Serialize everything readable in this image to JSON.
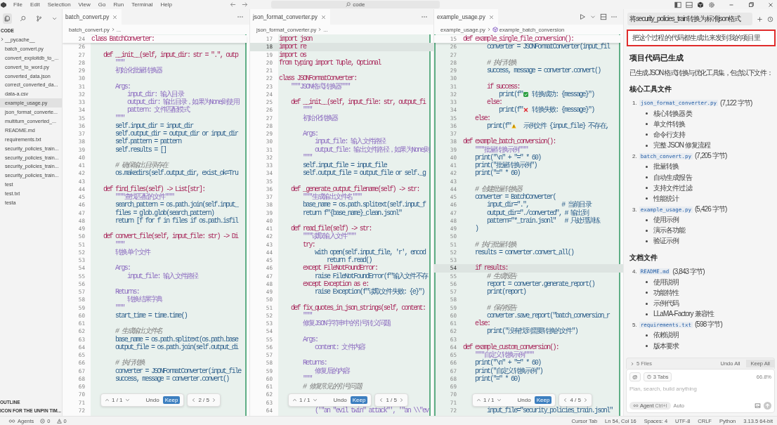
{
  "menu": [
    "File",
    "Edit",
    "Selection",
    "View",
    "Go",
    "Run",
    "Terminal",
    "Help"
  ],
  "search": {
    "value": "code"
  },
  "sidebar": {
    "title": "CODE",
    "files": [
      {
        "name": "__pycache__",
        "kind": "folder",
        "selected": false
      },
      {
        "name": "batch_convert.py",
        "kind": "file",
        "selected": false
      },
      {
        "name": "convert_exploitdb_to_...",
        "kind": "file",
        "selected": false
      },
      {
        "name": "convert_to_word.py",
        "kind": "file",
        "selected": false
      },
      {
        "name": "converted_data.json",
        "kind": "file",
        "selected": false
      },
      {
        "name": "correct_converted_da...",
        "kind": "file",
        "selected": false
      },
      {
        "name": "data-a.csv",
        "kind": "file",
        "selected": false
      },
      {
        "name": "example_usage.py",
        "kind": "file",
        "selected": true
      },
      {
        "name": "json_format_converte...",
        "kind": "file",
        "selected": false
      },
      {
        "name": "multiturn_converted_...",
        "kind": "file",
        "selected": false
      },
      {
        "name": "README.md",
        "kind": "file",
        "selected": false
      },
      {
        "name": "requirements.txt",
        "kind": "file",
        "selected": false
      },
      {
        "name": "security_policies_train...",
        "kind": "file",
        "selected": false
      },
      {
        "name": "security_policies_train...",
        "kind": "file",
        "selected": false
      },
      {
        "name": "security_policies_train...",
        "kind": "file",
        "selected": false
      },
      {
        "name": "security_policies_train...",
        "kind": "file",
        "selected": false
      },
      {
        "name": "test",
        "kind": "file",
        "selected": false
      },
      {
        "name": "test.txt",
        "kind": "file",
        "selected": false
      },
      {
        "name": "testa",
        "kind": "file",
        "selected": false
      }
    ],
    "sections": [
      "OUTLINE",
      "ICON FOR THE UNPIN TIM..."
    ]
  },
  "panes": [
    {
      "tab": "batch_convert.py",
      "breadcrumb": "batch_convert.py",
      "crumb_more": "...",
      "run_controls": false,
      "sticky": {
        "n": "24",
        "text": "class BatchConverter:",
        "kind": "kw"
      },
      "review": {
        "hunk": "1 / 1",
        "undo": "Undo",
        "keep": "Keep",
        "file_counter": "2 / 5"
      },
      "lines": [
        {
          "n": "26",
          "kind": "blank",
          "current": false
        },
        {
          "n": "27",
          "text": "    def __init__(self, input_dir: str = \".\", outp",
          "kind": "kw",
          "current": false
        },
        {
          "n": "28",
          "text": "        \"\"\"",
          "kind": "doc",
          "current": false
        },
        {
          "n": "29",
          "text": "        初始化批量转换器",
          "kind": "doc",
          "current": false
        },
        {
          "n": "30",
          "kind": "blank",
          "current": false
        },
        {
          "n": "31",
          "text": "        Args:",
          "kind": "doc",
          "current": false
        },
        {
          "n": "32",
          "text": "            input_dir: 输入目录",
          "kind": "doc",
          "current": false
        },
        {
          "n": "33",
          "text": "            output_dir: 输出目录，如果为None则使用",
          "kind": "doc",
          "current": false
        },
        {
          "n": "34",
          "text": "            pattern: 文件匹配模式",
          "kind": "doc",
          "current": false
        },
        {
          "n": "35",
          "text": "        \"\"\"",
          "kind": "doc",
          "current": false
        },
        {
          "n": "36",
          "text": "        self.input_dir = input_dir",
          "kind": "code",
          "current": false
        },
        {
          "n": "37",
          "text": "        self.output_dir = output_dir or input_dir",
          "kind": "code",
          "current": false
        },
        {
          "n": "38",
          "text": "        self.pattern = pattern",
          "kind": "code",
          "current": false
        },
        {
          "n": "39",
          "text": "        self.results = []",
          "kind": "code",
          "current": false
        },
        {
          "n": "40",
          "kind": "blank",
          "current": false
        },
        {
          "n": "41",
          "text": "        # 确保输出目录存在",
          "kind": "comment",
          "current": false
        },
        {
          "n": "42",
          "text": "        os.makedirs(self.output_dir, exist_ok=Tru",
          "kind": "code",
          "current": false
        },
        {
          "n": "43",
          "kind": "blank",
          "current": false
        },
        {
          "n": "44",
          "text": "    def find_files(self) -> List[str]:",
          "kind": "kw",
          "current": false
        },
        {
          "n": "45",
          "text": "        \"\"\"查找匹配的文件\"\"\"",
          "kind": "doc",
          "current": false
        },
        {
          "n": "46",
          "text": "        search_pattern = os.path.join(self.input_",
          "kind": "code",
          "current": false
        },
        {
          "n": "47",
          "text": "        files = glob.glob(search_pattern)",
          "kind": "code",
          "current": false
        },
        {
          "n": "48",
          "text": "        return [f for f in files if os.path.isfil",
          "kind": "code",
          "current": false
        },
        {
          "n": "49",
          "kind": "blank",
          "current": false
        },
        {
          "n": "50",
          "text": "    def convert_file(self, input_file: str) -> Di",
          "kind": "kw",
          "current": false
        },
        {
          "n": "51",
          "text": "        \"\"\"",
          "kind": "doc",
          "current": false
        },
        {
          "n": "52",
          "text": "        转换单个文件",
          "kind": "doc",
          "current": false
        },
        {
          "n": "53",
          "kind": "blank",
          "current": false
        },
        {
          "n": "54",
          "text": "        Args:",
          "kind": "doc",
          "current": false
        },
        {
          "n": "55",
          "text": "            input_file: 输入文件路径",
          "kind": "doc",
          "current": false
        },
        {
          "n": "56",
          "kind": "blank",
          "current": false
        },
        {
          "n": "57",
          "text": "        Returns:",
          "kind": "doc",
          "current": false
        },
        {
          "n": "58",
          "text": "            转换结果字典",
          "kind": "doc",
          "current": false
        },
        {
          "n": "59",
          "text": "        \"\"\"",
          "kind": "doc",
          "current": false
        },
        {
          "n": "60",
          "text": "        start_time = time.time()",
          "kind": "code",
          "current": false
        },
        {
          "n": "61",
          "kind": "blank",
          "current": false
        },
        {
          "n": "62",
          "text": "        # 生成输出文件名",
          "kind": "comment",
          "current": false
        },
        {
          "n": "63",
          "text": "        base_name = os.path.splitext(os.path.base",
          "kind": "code",
          "current": false
        },
        {
          "n": "64",
          "text": "        output_file = os.path.join(self.output_di",
          "kind": "code",
          "current": false
        },
        {
          "n": "65",
          "kind": "blank",
          "current": false
        },
        {
          "n": "66",
          "text": "        # 执行转换",
          "kind": "comment",
          "current": false
        },
        {
          "n": "67",
          "text": "        converter = JSONFormatConverter(input_file",
          "kind": "code",
          "current": false
        },
        {
          "n": "68",
          "text": "        success, message = converter.convert()",
          "kind": "code",
          "current": false
        },
        {
          "n": "69",
          "kind": "blank",
          "current": false
        },
        {
          "n": "70",
          "kind": "blank",
          "current": false
        },
        {
          "n": "71",
          "kind": "blank",
          "current": false
        },
        {
          "n": "72",
          "kind": "blank",
          "current": false
        }
      ]
    },
    {
      "tab": "json_format_converter.py",
      "breadcrumb": "json_format_converter.py",
      "crumb_more": "...",
      "run_controls": false,
      "review": {
        "hunk": "1 / 1",
        "undo": "Undo",
        "keep": "Keep",
        "file_counter": "1 / 5"
      },
      "lines": [
        {
          "n": "17",
          "text": "import json",
          "kind": "kw",
          "current": false
        },
        {
          "n": "18",
          "text": "import re",
          "kind": "kw",
          "current": true
        },
        {
          "n": "19",
          "text": "import os",
          "kind": "kw",
          "current": false
        },
        {
          "n": "20",
          "text": "from typing import Tuple, Optional",
          "kind": "kw",
          "current": false
        },
        {
          "n": "21",
          "kind": "blank",
          "current": false
        },
        {
          "n": "22",
          "text": "class JSONFormatConverter:",
          "kind": "kw",
          "current": false
        },
        {
          "n": "23",
          "text": "    \"\"\"JSON格式转换器\"\"\"",
          "kind": "doc",
          "current": false
        },
        {
          "n": "24",
          "kind": "blank",
          "current": false
        },
        {
          "n": "25",
          "text": "    def __init__(self, input_file: str, output_fi",
          "kind": "kw",
          "current": false
        },
        {
          "n": "26",
          "text": "        \"\"\"",
          "kind": "doc",
          "current": false
        },
        {
          "n": "27",
          "text": "        初始化转换器",
          "kind": "doc",
          "current": false
        },
        {
          "n": "28",
          "kind": "blank",
          "current": false
        },
        {
          "n": "29",
          "text": "        Args:",
          "kind": "doc",
          "current": false
        },
        {
          "n": "30",
          "text": "            input_file: 输入文件路径",
          "kind": "doc",
          "current": false
        },
        {
          "n": "31",
          "text": "            output_file: 输出文件路径，如果为None则",
          "kind": "doc",
          "current": false
        },
        {
          "n": "32",
          "text": "        \"\"\"",
          "kind": "doc",
          "current": false
        },
        {
          "n": "33",
          "text": "        self.input_file = input_file",
          "kind": "code",
          "current": false
        },
        {
          "n": "34",
          "text": "        self.output_file = output_file or self._g",
          "kind": "code",
          "current": false
        },
        {
          "n": "35",
          "kind": "blank",
          "current": false
        },
        {
          "n": "36",
          "text": "    def _generate_output_filename(self) -> str:",
          "kind": "kw",
          "current": false
        },
        {
          "n": "37",
          "text": "        \"\"\"生成输出文件名\"\"\"",
          "kind": "doc",
          "current": false
        },
        {
          "n": "38",
          "text": "        base_name = os.path.splitext(self.input_f",
          "kind": "code",
          "current": false
        },
        {
          "n": "39",
          "text": "        return f\"{base_name}_clean.jsonl\"",
          "kind": "code",
          "current": false
        },
        {
          "n": "40",
          "kind": "blank",
          "current": false
        },
        {
          "n": "41",
          "text": "    def read_file(self) -> str:",
          "kind": "kw",
          "current": false
        },
        {
          "n": "42",
          "text": "        \"\"\"读取输入文件\"\"\"",
          "kind": "doc",
          "current": false
        },
        {
          "n": "43",
          "text": "        try:",
          "kind": "kw",
          "current": false
        },
        {
          "n": "44",
          "text": "            with open(self.input_file, 'r', encod",
          "kind": "code",
          "current": false
        },
        {
          "n": "45",
          "text": "                return f.read()",
          "kind": "code",
          "current": false
        },
        {
          "n": "46",
          "text": "        except FileNotFoundError:",
          "kind": "kw",
          "current": false
        },
        {
          "n": "47",
          "text": "            raise FileNotFoundError(f\"输入文件不存",
          "kind": "code",
          "current": false
        },
        {
          "n": "48",
          "text": "        except Exception as e:",
          "kind": "kw",
          "current": false
        },
        {
          "n": "49",
          "text": "            raise Exception(f\"读取文件失败: {e}\")",
          "kind": "code",
          "current": false
        },
        {
          "n": "50",
          "kind": "blank",
          "current": false
        },
        {
          "n": "51",
          "text": "    def fix_quotes_in_json_strings(self, content:",
          "kind": "kw",
          "current": false
        },
        {
          "n": "52",
          "text": "        \"\"\"",
          "kind": "doc",
          "current": false
        },
        {
          "n": "53",
          "text": "        修复JSON字符串中的引号转义问题",
          "kind": "doc",
          "current": false
        },
        {
          "n": "54",
          "kind": "blank",
          "current": false
        },
        {
          "n": "55",
          "text": "        Args:",
          "kind": "doc",
          "current": false
        },
        {
          "n": "56",
          "text": "            content: 文件内容",
          "kind": "doc",
          "current": false
        },
        {
          "n": "57",
          "kind": "blank",
          "current": false
        },
        {
          "n": "58",
          "text": "        Returns:",
          "kind": "doc",
          "current": false
        },
        {
          "n": "59",
          "text": "            修复后的内容",
          "kind": "doc",
          "current": false
        },
        {
          "n": "60",
          "text": "        \"\"\"",
          "kind": "doc",
          "current": false
        },
        {
          "n": "61",
          "text": "        # 修复常见的引号问题",
          "kind": "comment",
          "current": false
        },
        {
          "n": "62",
          "kind": "blank",
          "current": false
        },
        {
          "n": "63",
          "kind": "blank",
          "current": false
        },
        {
          "n": "64",
          "text": "            ('\"an \"evil twin\" attack\"', '\"an \\\\\"ev",
          "kind": "doc",
          "current": false
        }
      ]
    },
    {
      "tab": "example_usage.py",
      "breadcrumb": "example_usage.py",
      "crumb_more": "example_batch_conversion",
      "run_controls": true,
      "sticky": {
        "n": "15",
        "text": "def example_single_file_conversion():",
        "kind": "kw"
      },
      "review": {
        "hunk": "1 / 1",
        "undo": "Undo",
        "keep": "Keep",
        "file_counter": "4 / 5"
      },
      "lines": [
        {
          "n": "26",
          "text": "        converter = JSONFormatConverter(input_fil",
          "kind": "code",
          "current": false
        },
        {
          "n": "27",
          "kind": "blank",
          "current": false
        },
        {
          "n": "28",
          "text": "        # 执行转换",
          "kind": "comment",
          "current": false
        },
        {
          "n": "29",
          "text": "        success, message = converter.convert()",
          "kind": "code",
          "current": false
        },
        {
          "n": "30",
          "kind": "blank",
          "current": false
        },
        {
          "n": "31",
          "text": "        if success:",
          "kind": "kw",
          "current": false
        },
        {
          "n": "32",
          "text": "            print(f\"",
          "after": " 转换成功: {message}\")",
          "kind": "success",
          "current": false
        },
        {
          "n": "33",
          "text": "        else:",
          "kind": "kw",
          "current": false
        },
        {
          "n": "34",
          "text": "            print(f\"",
          "after": " 转换失败: {message}\")",
          "kind": "failure",
          "current": false
        },
        {
          "n": "35",
          "text": "    else:",
          "kind": "kw",
          "current": false
        },
        {
          "n": "36",
          "text": "        print(f\"",
          "after": "  示例文件 {input_file} 不存在,",
          "kind": "warning",
          "current": false
        },
        {
          "n": "37",
          "kind": "blank",
          "current": false
        },
        {
          "n": "38",
          "text": "def example_batch_conversion():",
          "kind": "kw",
          "current": false
        },
        {
          "n": "39",
          "text": "    \"\"\"批量转换示例\"\"\"",
          "kind": "doc",
          "current": false
        },
        {
          "n": "40",
          "text": "    print(\"\\n\" + \"=\" * 60)",
          "kind": "code",
          "current": false
        },
        {
          "n": "41",
          "text": "    print(\"批量转换示例\")",
          "kind": "code",
          "current": false
        },
        {
          "n": "42",
          "text": "    print(\"=\" * 60)",
          "kind": "code",
          "current": false
        },
        {
          "n": "43",
          "kind": "blank",
          "current": false
        },
        {
          "n": "44",
          "text": "    # 创建批量转换器",
          "kind": "comment",
          "current": false
        },
        {
          "n": "45",
          "text": "    converter = BatchConverter(",
          "kind": "code",
          "current": false
        },
        {
          "n": "46",
          "text": "        input_dir=\".\",           # 当前目录",
          "kind": "code",
          "current": false
        },
        {
          "n": "47",
          "text": "        output_dir=\"./converted\", # 输出到",
          "kind": "code",
          "current": false
        },
        {
          "n": "48",
          "text": "        pattern=\"*_train.jsonl\"   # 只处理训练",
          "kind": "code",
          "current": false
        },
        {
          "n": "49",
          "text": "    )",
          "kind": "code",
          "current": false
        },
        {
          "n": "50",
          "kind": "blank",
          "current": false
        },
        {
          "n": "51",
          "text": "    # 执行批量转换",
          "kind": "comment",
          "current": false
        },
        {
          "n": "52",
          "text": "    results = converter.convert_all()",
          "kind": "code",
          "current": false
        },
        {
          "n": "53",
          "kind": "blank",
          "current": false
        },
        {
          "n": "54",
          "text": "    if results:",
          "kind": "kw",
          "current": true
        },
        {
          "n": "55",
          "text": "        # 生成报告",
          "kind": "comment",
          "current": false
        },
        {
          "n": "56",
          "text": "        report = converter.generate_report()",
          "kind": "code",
          "current": false
        },
        {
          "n": "57",
          "text": "        print(report)",
          "kind": "code",
          "current": false
        },
        {
          "n": "58",
          "kind": "blank",
          "current": false
        },
        {
          "n": "59",
          "text": "        # 保存报告",
          "kind": "comment",
          "current": false
        },
        {
          "n": "60",
          "text": "        converter.save_report(\"batch_conversion_r",
          "kind": "code",
          "current": false
        },
        {
          "n": "61",
          "text": "    else:",
          "kind": "kw",
          "current": false
        },
        {
          "n": "62",
          "text": "        print(\"没有找到需要转换的文件\")",
          "kind": "code",
          "current": false
        },
        {
          "n": "63",
          "kind": "blank",
          "current": false
        },
        {
          "n": "64",
          "text": "def example_custom_conversion():",
          "kind": "kw",
          "current": false
        },
        {
          "n": "65",
          "text": "    \"\"\"自定义转换示例\"\"\"",
          "kind": "doc",
          "current": false
        },
        {
          "n": "66",
          "text": "    print(\"\\n\" + \"=\" * 60)",
          "kind": "code",
          "current": false
        },
        {
          "n": "67",
          "text": "    print(\"自定义转换示例\")",
          "kind": "code",
          "current": false
        },
        {
          "n": "68",
          "text": "    print(\"=\" * 60)",
          "kind": "code",
          "current": false
        },
        {
          "n": "69",
          "kind": "blank",
          "current": false
        },
        {
          "n": "70",
          "kind": "blank",
          "current": false
        },
        {
          "n": "71",
          "kind": "blank",
          "current": false
        },
        {
          "n": "72",
          "text": "        input_file=\"security_policies_train.jsonl\"",
          "kind": "code",
          "current": false
        }
      ]
    }
  ],
  "chat": {
    "tab_title": "将security_policies_train转换为标准json格式",
    "user_message": "把这个过程的代码都生成出来发到我的项目里",
    "heading": "项目代码已生成",
    "intro": "已生成 JSON 格式转换与优化工具集，包含以下文件：",
    "sections": [
      {
        "title": "核心工具文件",
        "files": [
          {
            "num": "1.",
            "name": "json_format_converter.py",
            "size": "(7,122 字节)",
            "bullets": [
              "核心转换器类",
              "单文件转换",
              "命令行支持",
              "完整 JSON 修复流程"
            ]
          },
          {
            "num": "2.",
            "name": "batch_convert.py",
            "size": "(7,205 字节)",
            "bullets": [
              "批量转换",
              "自动生成报告",
              "支持文件过滤",
              "性能统计"
            ]
          },
          {
            "num": "3.",
            "name": "example_usage.py",
            "size": "(5,426 字节)",
            "bullets": [
              "使用示例",
              "演示各功能",
              "验证示例"
            ]
          }
        ]
      },
      {
        "title": "文档文件",
        "files": [
          {
            "num": "4.",
            "name": "README.md",
            "size": "(3,843 字节)",
            "bullets": [
              "使用说明",
              "功能特性",
              "示例代码",
              "LLaMA-Factory 兼容性"
            ]
          },
          {
            "num": "5.",
            "name": "requirements.txt",
            "size": "(598 字节)",
            "bullets": [
              "依赖说明",
              "版本要求"
            ]
          }
        ]
      }
    ],
    "files_bar": {
      "count": "5 Files",
      "undo": "Undo All",
      "keep": "Keep All"
    },
    "composer": {
      "mention": "@",
      "tabs": "3 Tabs",
      "context": "66.8%",
      "placeholder": "Plan, search, build anything",
      "mode": "Agent",
      "shortcut": "Ctrl+I",
      "model": "Auto"
    }
  },
  "status": {
    "agents": "Agents",
    "errors": "0",
    "warnings": "0",
    "right": [
      "Cursor Tab",
      "Ln 54, Col 16",
      "Spaces: 4",
      "UTF-8",
      "CRLF",
      "Python",
      "3.13.5 64-bit"
    ]
  }
}
